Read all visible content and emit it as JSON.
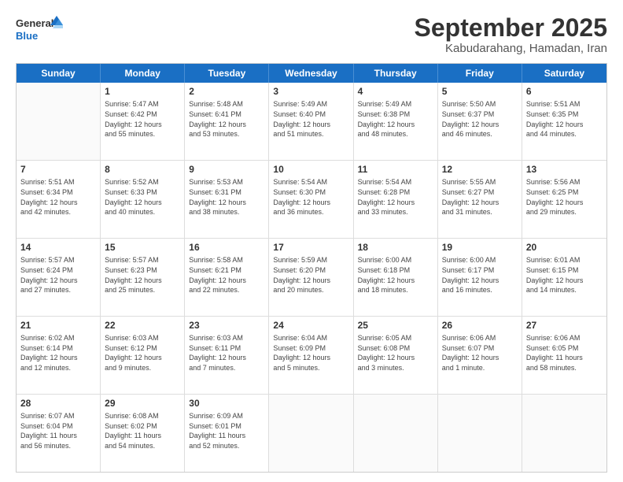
{
  "logo": {
    "line1": "General",
    "line2": "Blue"
  },
  "title": "September 2025",
  "subtitle": "Kabudarahang, Hamadan, Iran",
  "header_days": [
    "Sunday",
    "Monday",
    "Tuesday",
    "Wednesday",
    "Thursday",
    "Friday",
    "Saturday"
  ],
  "weeks": [
    [
      {
        "day": "",
        "text": ""
      },
      {
        "day": "1",
        "text": "Sunrise: 5:47 AM\nSunset: 6:42 PM\nDaylight: 12 hours\nand 55 minutes."
      },
      {
        "day": "2",
        "text": "Sunrise: 5:48 AM\nSunset: 6:41 PM\nDaylight: 12 hours\nand 53 minutes."
      },
      {
        "day": "3",
        "text": "Sunrise: 5:49 AM\nSunset: 6:40 PM\nDaylight: 12 hours\nand 51 minutes."
      },
      {
        "day": "4",
        "text": "Sunrise: 5:49 AM\nSunset: 6:38 PM\nDaylight: 12 hours\nand 48 minutes."
      },
      {
        "day": "5",
        "text": "Sunrise: 5:50 AM\nSunset: 6:37 PM\nDaylight: 12 hours\nand 46 minutes."
      },
      {
        "day": "6",
        "text": "Sunrise: 5:51 AM\nSunset: 6:35 PM\nDaylight: 12 hours\nand 44 minutes."
      }
    ],
    [
      {
        "day": "7",
        "text": "Sunrise: 5:51 AM\nSunset: 6:34 PM\nDaylight: 12 hours\nand 42 minutes."
      },
      {
        "day": "8",
        "text": "Sunrise: 5:52 AM\nSunset: 6:33 PM\nDaylight: 12 hours\nand 40 minutes."
      },
      {
        "day": "9",
        "text": "Sunrise: 5:53 AM\nSunset: 6:31 PM\nDaylight: 12 hours\nand 38 minutes."
      },
      {
        "day": "10",
        "text": "Sunrise: 5:54 AM\nSunset: 6:30 PM\nDaylight: 12 hours\nand 36 minutes."
      },
      {
        "day": "11",
        "text": "Sunrise: 5:54 AM\nSunset: 6:28 PM\nDaylight: 12 hours\nand 33 minutes."
      },
      {
        "day": "12",
        "text": "Sunrise: 5:55 AM\nSunset: 6:27 PM\nDaylight: 12 hours\nand 31 minutes."
      },
      {
        "day": "13",
        "text": "Sunrise: 5:56 AM\nSunset: 6:25 PM\nDaylight: 12 hours\nand 29 minutes."
      }
    ],
    [
      {
        "day": "14",
        "text": "Sunrise: 5:57 AM\nSunset: 6:24 PM\nDaylight: 12 hours\nand 27 minutes."
      },
      {
        "day": "15",
        "text": "Sunrise: 5:57 AM\nSunset: 6:23 PM\nDaylight: 12 hours\nand 25 minutes."
      },
      {
        "day": "16",
        "text": "Sunrise: 5:58 AM\nSunset: 6:21 PM\nDaylight: 12 hours\nand 22 minutes."
      },
      {
        "day": "17",
        "text": "Sunrise: 5:59 AM\nSunset: 6:20 PM\nDaylight: 12 hours\nand 20 minutes."
      },
      {
        "day": "18",
        "text": "Sunrise: 6:00 AM\nSunset: 6:18 PM\nDaylight: 12 hours\nand 18 minutes."
      },
      {
        "day": "19",
        "text": "Sunrise: 6:00 AM\nSunset: 6:17 PM\nDaylight: 12 hours\nand 16 minutes."
      },
      {
        "day": "20",
        "text": "Sunrise: 6:01 AM\nSunset: 6:15 PM\nDaylight: 12 hours\nand 14 minutes."
      }
    ],
    [
      {
        "day": "21",
        "text": "Sunrise: 6:02 AM\nSunset: 6:14 PM\nDaylight: 12 hours\nand 12 minutes."
      },
      {
        "day": "22",
        "text": "Sunrise: 6:03 AM\nSunset: 6:12 PM\nDaylight: 12 hours\nand 9 minutes."
      },
      {
        "day": "23",
        "text": "Sunrise: 6:03 AM\nSunset: 6:11 PM\nDaylight: 12 hours\nand 7 minutes."
      },
      {
        "day": "24",
        "text": "Sunrise: 6:04 AM\nSunset: 6:09 PM\nDaylight: 12 hours\nand 5 minutes."
      },
      {
        "day": "25",
        "text": "Sunrise: 6:05 AM\nSunset: 6:08 PM\nDaylight: 12 hours\nand 3 minutes."
      },
      {
        "day": "26",
        "text": "Sunrise: 6:06 AM\nSunset: 6:07 PM\nDaylight: 12 hours\nand 1 minute."
      },
      {
        "day": "27",
        "text": "Sunrise: 6:06 AM\nSunset: 6:05 PM\nDaylight: 11 hours\nand 58 minutes."
      }
    ],
    [
      {
        "day": "28",
        "text": "Sunrise: 6:07 AM\nSunset: 6:04 PM\nDaylight: 11 hours\nand 56 minutes."
      },
      {
        "day": "29",
        "text": "Sunrise: 6:08 AM\nSunset: 6:02 PM\nDaylight: 11 hours\nand 54 minutes."
      },
      {
        "day": "30",
        "text": "Sunrise: 6:09 AM\nSunset: 6:01 PM\nDaylight: 11 hours\nand 52 minutes."
      },
      {
        "day": "",
        "text": ""
      },
      {
        "day": "",
        "text": ""
      },
      {
        "day": "",
        "text": ""
      },
      {
        "day": "",
        "text": ""
      }
    ]
  ]
}
